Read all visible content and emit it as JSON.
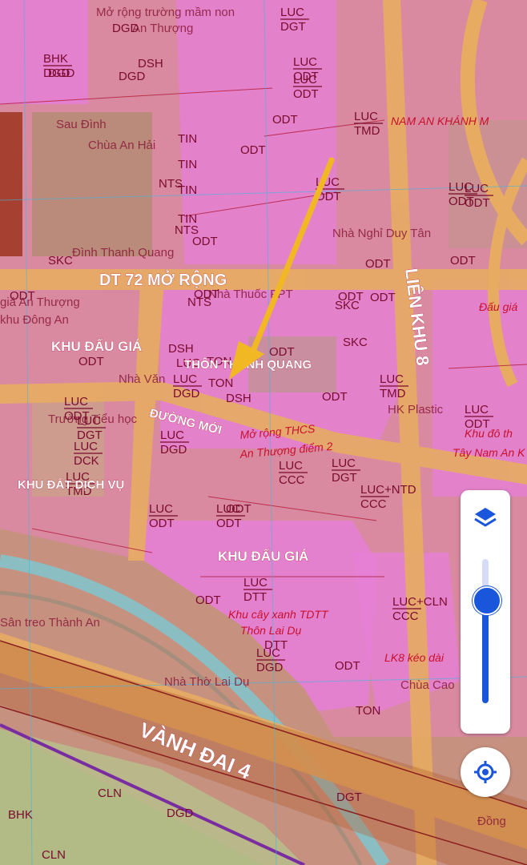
{
  "map": {
    "major_labels": {
      "dt72": "DT 72 MỞ RỘNG",
      "lien_khu": "LIÊN KHU 8",
      "vanh_dai": "VÀNH ĐAI 4",
      "duong_moi": "ĐƯỜNG MỚI",
      "khu_dau_gia_1": "KHU ĐẤU GIÁ",
      "khu_dau_gia_2": "KHU ĐẤU GIÁ",
      "khu_dich_vu": "KHU ĐẤT DỊCH VỤ"
    },
    "place_labels": {
      "sau_dinh": "Sau Đình",
      "chua_an_hai": "Chùa An Hải",
      "thon_thanh_quang": "THÔN THANH QUANG",
      "nha_nghi": "Nhà Nghỉ Duy Tân",
      "hk_plastic": "HK Plastic",
      "san_treo": "Sân treo Thành An",
      "nha_tho": "Nhà Thờ Lai Dụ",
      "chua_cao": "Chùa Cao",
      "nam_an_khanh": "NAM AN KHÁNH M",
      "tay_nam_an": "Tây Nam An K",
      "khu_do_thi": "Khu đô th",
      "khu_cay_xanh": "Khu cây xanh TDTT",
      "thon_lai_du": "Thôn Lai Dụ",
      "lk8": "LK8 kéo dài",
      "dong": "Đồng",
      "mo_rong_truong": "Mở rộng trường mầm non",
      "an_thuong": "An Thượng",
      "thcs": "Mở rộng THCS",
      "an_thuong_diem": "An Thượng điểm 2",
      "dau_gia_an_thuong": "giá An Thượng",
      "khu_dong_an": "khu Đông An",
      "nha_van_hoa": "Nhà Văn",
      "truong_tieu_hoc": "Trường Tiểu học",
      "dinh": "Đình Thanh Quang",
      "nha_thuoc": "Nhà Thuốc FPT",
      "dau_gia_right": "Đấu giá"
    },
    "zone_codes": [
      {
        "top": "LUC",
        "bottom": "DGT"
      },
      {
        "top": "BHK",
        "bottom": "DGD"
      },
      {
        "top": "LUC",
        "bottom": "ODT"
      },
      {
        "top": "LUC",
        "bottom": "TMD"
      },
      {
        "top": "LUC",
        "bottom": "ODT"
      },
      {
        "top": "LUC",
        "bottom": "ODT"
      },
      {
        "top": "LUC",
        "bottom": "ODT"
      },
      {
        "top": "LUC",
        "bottom": "TMD"
      },
      {
        "top": "LUC",
        "bottom": "DGD"
      },
      {
        "top": "LUC",
        "bottom": "ODT"
      },
      {
        "top": "LUC",
        "bottom": "DGT"
      },
      {
        "top": "LUC",
        "bottom": "DCK"
      },
      {
        "top": "LUC",
        "bottom": "TMD"
      },
      {
        "top": "LUC",
        "bottom": "DGD"
      },
      {
        "top": "LUC",
        "bottom": "CCC"
      },
      {
        "top": "LUC",
        "bottom": "DGT"
      },
      {
        "top": "LUC+NTD",
        "bottom": "CCC"
      },
      {
        "top": "LUC",
        "bottom": "ODT"
      },
      {
        "top": "LUC",
        "bottom": "ODT"
      },
      {
        "top": "LUC",
        "bottom": "DTT"
      },
      {
        "top": "LUC+CLN",
        "bottom": "CCC"
      },
      {
        "top": "LUC",
        "bottom": "ODT"
      },
      {
        "top": "LUC",
        "bottom": "DGD"
      },
      {
        "top": "LUC",
        "bottom": "ODT"
      }
    ],
    "single_codes": [
      "ODT",
      "ODT",
      "ODT",
      "ODT",
      "ODT",
      "ODT",
      "ODT",
      "ODT",
      "ODT",
      "ODT",
      "ODT",
      "ODT",
      "ODT",
      "ODT",
      "SKC",
      "SKC",
      "SKC",
      "DSH",
      "DSH",
      "DSH",
      "TIN",
      "TIN",
      "TIN",
      "TIN",
      "NTS",
      "NTS",
      "NTS",
      "TON",
      "TON",
      "TON",
      "DGD",
      "DTT",
      "DGD",
      "DGD",
      "CLN",
      "BHK",
      "CLN",
      "DGD",
      "LUC",
      "ODT",
      "DGT"
    ],
    "colors": {
      "residential": "#d98aa0",
      "urban_pink": "#e57fd6",
      "road": "#e7ac62",
      "agri": "#b9a17a",
      "arrow": "#f2b824",
      "brown_zone": "#a46a4f",
      "river": "#7fc5cf"
    }
  },
  "controls": {
    "layers_icon": "layers-icon",
    "locate_icon": "my-location-icon",
    "zoom_level_fraction": 0.72
  }
}
